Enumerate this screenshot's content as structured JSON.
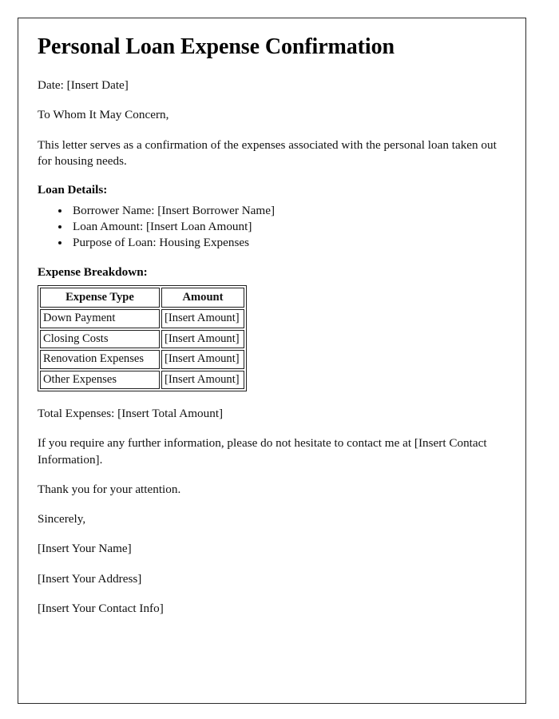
{
  "document": {
    "title": "Personal Loan Expense Confirmation",
    "date_line": "Date: [Insert Date]",
    "salutation": "To Whom It May Concern,",
    "intro_paragraph": "This letter serves as a confirmation of the expenses associated with the personal loan taken out for housing needs.",
    "loan_details": {
      "heading": "Loan Details:",
      "items": [
        "Borrower Name: [Insert Borrower Name]",
        "Loan Amount: [Insert Loan Amount]",
        "Purpose of Loan: Housing Expenses"
      ]
    },
    "expense_breakdown": {
      "heading": "Expense Breakdown:",
      "columns": [
        "Expense Type",
        "Amount"
      ],
      "rows": [
        [
          "Down Payment",
          "[Insert Amount]"
        ],
        [
          "Closing Costs",
          "[Insert Amount]"
        ],
        [
          "Renovation Expenses",
          "[Insert Amount]"
        ],
        [
          "Other Expenses",
          "[Insert Amount]"
        ]
      ]
    },
    "total_line": "Total Expenses: [Insert Total Amount]",
    "contact_paragraph": "If you require any further information, please do not hesitate to contact me at [Insert Contact Information].",
    "thanks_line": "Thank you for your attention.",
    "closing": "Sincerely,",
    "signature": [
      "[Insert Your Name]",
      "[Insert Your Address]",
      "[Insert Your Contact Info]"
    ]
  },
  "colors": {
    "page_background": "#ffffff",
    "page_border": "#2b2b2b",
    "text": "#111111",
    "table_border": "#1f1f1f"
  }
}
